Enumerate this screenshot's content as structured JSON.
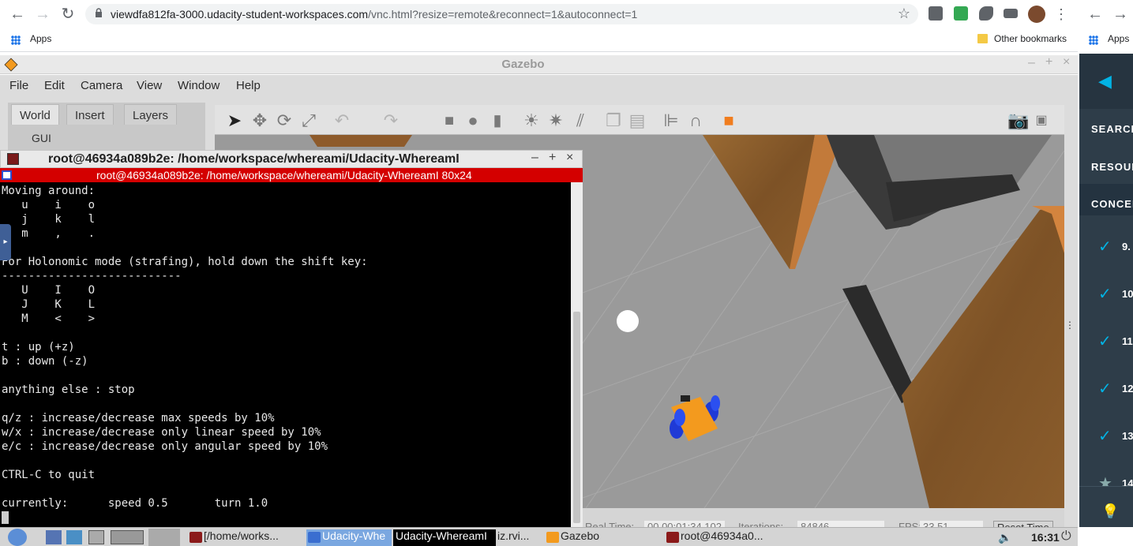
{
  "browser": {
    "url_host": "viewdfa812fa-3000.udacity-student-workspaces.com",
    "url_path": "/vnc.html?resize=remote&reconnect=1&autoconnect=1",
    "bookmarks": {
      "apps": "Apps",
      "other": "Other bookmarks"
    },
    "right_apps": "Apps"
  },
  "side_panel": {
    "items": [
      "SEARCH",
      "RESOUR",
      "CONCEP"
    ],
    "lessons": [
      "9.",
      "10",
      "11",
      "12",
      "13",
      "14"
    ]
  },
  "gazebo": {
    "title": "Gazebo",
    "menu": [
      "File",
      "Edit",
      "Camera",
      "View",
      "Window",
      "Help"
    ],
    "tabs": [
      "World",
      "Insert",
      "Layers"
    ],
    "tree_item": "GUI",
    "status": {
      "real_time_label": "Real Time:",
      "real_time": "00 00:01:34.102",
      "iterations_label": "Iterations:",
      "iterations": "84846",
      "fps_label": "FPS:",
      "fps": "33.51",
      "reset_label": "Reset Time"
    }
  },
  "terminal": {
    "title": "root@46934a089b2e: /home/workspace/whereami/Udacity-WhereamI",
    "subtitle": "root@46934a089b2e: /home/workspace/whereami/Udacity-WhereamI 80x24",
    "lines": [
      "Moving around:",
      "   u    i    o",
      "   j    k    l",
      "   m    ,    .",
      "",
      "For Holonomic mode (strafing), hold down the shift key:",
      "---------------------------",
      "   U    I    O",
      "   J    K    L",
      "   M    <    >",
      "",
      "t : up (+z)",
      "b : down (-z)",
      "",
      "anything else : stop",
      "",
      "q/z : increase/decrease max speeds by 10%",
      "w/x : increase/decrease only linear speed by 10%",
      "e/c : increase/decrease only angular speed by 10%",
      "",
      "CTRL-C to quit",
      "",
      "currently:      speed 0.5       turn 1.0"
    ]
  },
  "taskbar": {
    "tasks": [
      "[/home/works...",
      "Udacity-Whe",
      "Udacity-WhereamI",
      "iz.rvi...",
      "Gazebo",
      "root@46934a0..."
    ],
    "clock": "16:31"
  },
  "colors": {
    "terminal_red": "#d40000",
    "panel_dark": "#2e3d49",
    "accent_cyan": "#02b3e4",
    "robot_orange": "#f39a1e"
  }
}
